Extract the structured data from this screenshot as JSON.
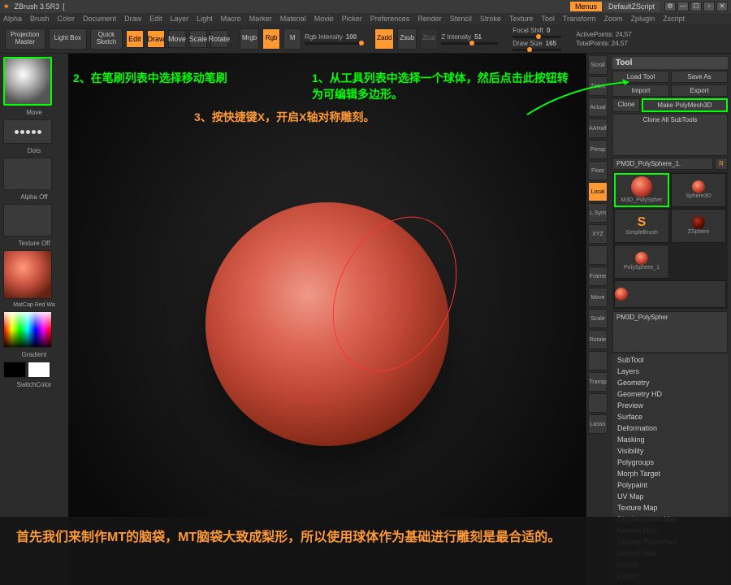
{
  "titlebar": {
    "app": "ZBrush 3.5R3",
    "doc": "[",
    "menus": "Menus",
    "zscript": "DefaultZScript"
  },
  "menubar": {
    "left": [
      "Alpha",
      "Brush",
      "Color",
      "Document",
      "Draw",
      "Edit",
      "Layer",
      "Light",
      "Macro",
      "Marker",
      "Material",
      "Movie",
      "Picker",
      "Preferences",
      "Render",
      "Stencil",
      "Stroke",
      "Texture",
      "Tool",
      "Transform",
      "Zoom",
      "Zplugin",
      "Zscript"
    ]
  },
  "toolbar": {
    "projection": "Projection\nMaster",
    "lightbox": "Light Box",
    "quicksketch": "Quick\nSketch",
    "edit": "Edit",
    "draw": "Draw",
    "move": "Move",
    "scale": "Scale",
    "rotate": "Rotate",
    "mrgb": "Mrgb",
    "rgb": "Rgb",
    "m": "M",
    "rgb_intensity_label": "Rgb Intensity",
    "rgb_intensity": "100",
    "zadd": "Zadd",
    "zsub": "Zsub",
    "zcut": "Zcut",
    "z_intensity_label": "Z Intensity",
    "z_intensity": "51",
    "focal_label": "Focal Shift",
    "focal": "0",
    "drawsize_label": "Draw Size",
    "drawsize": "165",
    "activepoints_label": "ActivePoints:",
    "activepoints": "24,57",
    "totalpoints_label": "TotalPoints:",
    "totalpoints": "24,57"
  },
  "left": {
    "brush_label": "Move",
    "stroke_label": "Dots",
    "alpha_label": "Alpha Off",
    "texture_label": "Texture Off",
    "material_label": "MatCap Red Wa",
    "gradient": "Gradient",
    "switchcolor": "SwitchColor"
  },
  "right_icons": [
    "Scroll",
    "Zoom",
    "Actual",
    "AAHalf",
    "Persp",
    "Floor",
    "Local",
    "L.Sym",
    "XYZ",
    "",
    "Frame",
    "Move",
    "Scale",
    "Rotate",
    "",
    "Transp",
    "",
    "Lasso"
  ],
  "right_icons_orange": [
    6
  ],
  "tool": {
    "title": "Tool",
    "load": "Load Tool",
    "save": "Save As",
    "import": "Import",
    "export": "Export",
    "clone": "Clone",
    "makepoly": "Make PolyMesh3D",
    "cloneall": "Clone All SubTools",
    "current": "PM3D_PolySphere_1.",
    "r": "R",
    "subtools": [
      {
        "name": "M3D_PolySpher",
        "sel": true
      },
      {
        "name": "Sphere3D"
      },
      {
        "name": "SimpleBrush",
        "s": true
      },
      {
        "name": "ZSphere",
        "dark": true
      },
      {
        "name": "PolySphere_1"
      }
    ],
    "current2": "PM3D_PolySpher",
    "sections": [
      "SubTool",
      "Layers",
      "Geometry",
      "Geometry HD",
      "Preview",
      "Surface",
      "Deformation",
      "Masking",
      "Visibility",
      "Polygroups",
      "Morph Target",
      "Polypaint",
      "UV Map",
      "Texture Map",
      "Displacement Map",
      "Normal Map",
      "Display Properties",
      "Unified Skin",
      "Import",
      "Export"
    ]
  },
  "annotations": {
    "a1": "1、从工具列表中选择一个球体，然后点击此按钮转为可编辑多边形。",
    "a2": "2、在笔刷列表中选择移动笔刷",
    "a3": "3、按快捷键X，开启X轴对称雕刻。"
  },
  "caption": "首先我们来制作MT的脑袋，MT脑袋大致成梨形，所以使用球体作为基础进行雕刻是最合适的。"
}
